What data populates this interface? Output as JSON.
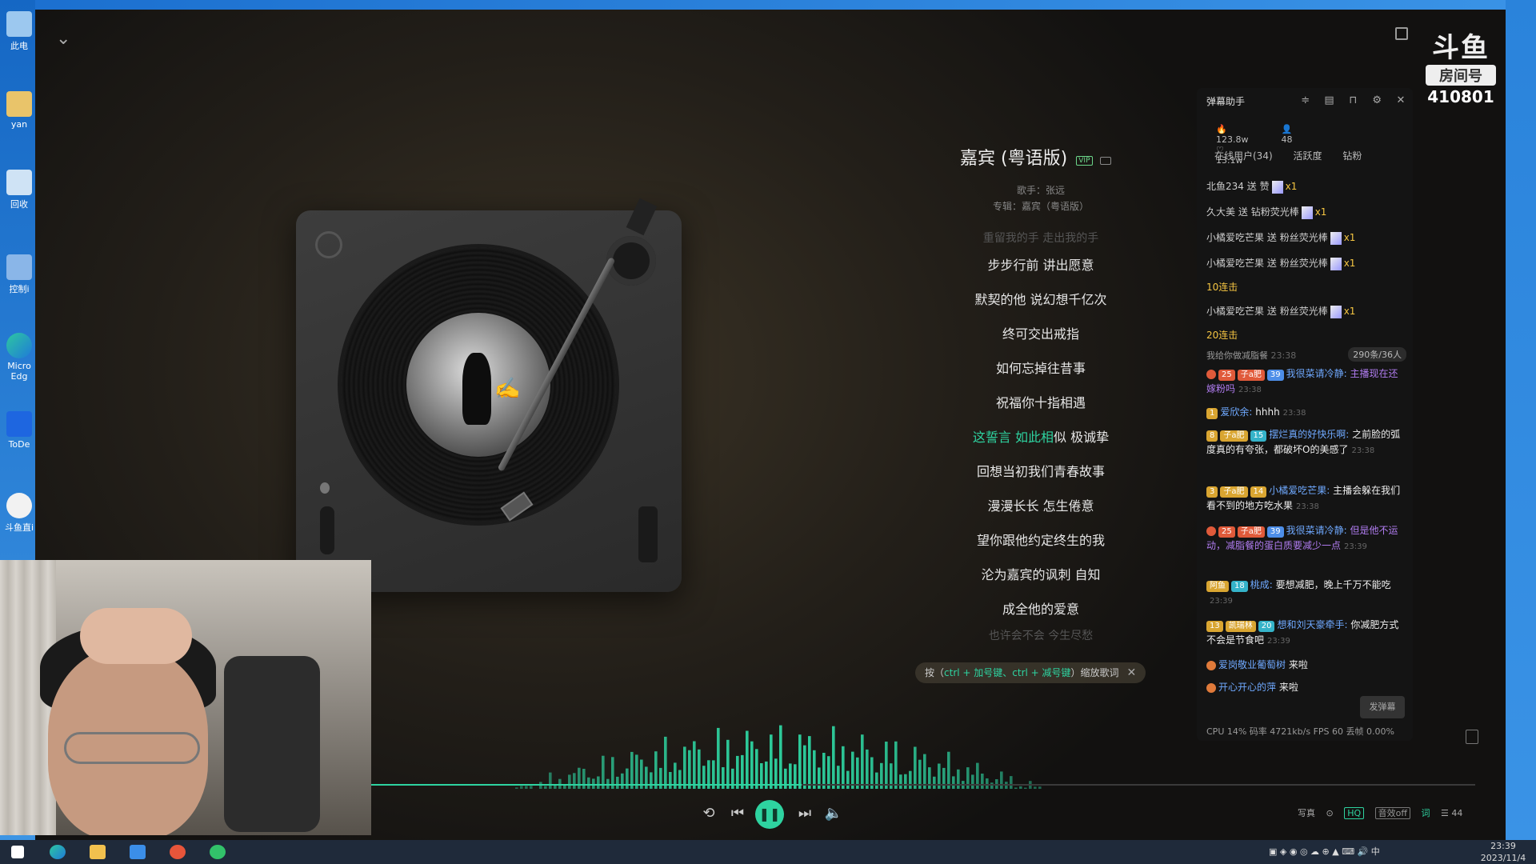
{
  "desktop": {
    "icons": [
      {
        "label": "此电"
      },
      {
        "label": "yan"
      },
      {
        "label": "回收"
      },
      {
        "label": "控制i"
      },
      {
        "label": "Micro Edg"
      },
      {
        "label": "ToDe"
      },
      {
        "label": "斗鱼直i"
      }
    ]
  },
  "room": {
    "logo_text": "斗鱼",
    "tag": "房间号",
    "number": "410801"
  },
  "song": {
    "title": "嘉宾 (粤语版)",
    "vip": "VIP",
    "singer": "歌手：张远",
    "album": "专辑：嘉宾（粤语版）"
  },
  "lyrics": {
    "prev_faded": "重留我的手 走出我的手",
    "lines": [
      "步步行前 讲出愿意",
      "默契的他 说幻想千亿次",
      "终可交出戒指",
      "如何忘掉往昔事",
      "祝福你十指相遇",
      "回想当初我们青春故事",
      "漫漫长长 怎生倦意",
      "望你跟他约定终生的我",
      "沦为嘉宾的讽刺 自知",
      "成全他的爱意"
    ],
    "active_line_hl": "这誓言 如此相",
    "active_line_rest": "似 极诚挚",
    "next_faded": "也许会不会 今生尽愁"
  },
  "zoom_tip": {
    "prefix": "按（",
    "keys": "ctrl + 加号键、ctrl + 减号键",
    "suffix": "）缩放歌词",
    "close": "✕"
  },
  "player": {
    "progress": 0.39,
    "accent": "#2ed3a0",
    "right_controls": {
      "xiezhen": "写真",
      "hq": "HQ",
      "sound": "音效off",
      "ci": "词",
      "count": "44"
    }
  },
  "danmu": {
    "title": "弹幕助手",
    "stats": {
      "heat": "123.8w",
      "users": "48",
      "likes": "13.1w"
    },
    "tabs": [
      "在线用户(34)",
      "活跃度",
      "钻粉"
    ],
    "gifts": [
      {
        "user": "北鱼234",
        "verb": "送",
        "item": "赞",
        "qty": "x1"
      },
      {
        "user": "久大美",
        "verb": "送",
        "item": "钻粉荧光棒",
        "qty": "x1"
      },
      {
        "user": "小橘爱吃芒果",
        "verb": "送",
        "item": "粉丝荧光棒",
        "qty": "x1"
      },
      {
        "user": "小橘爱吃芒果",
        "verb": "送",
        "item": "粉丝荧光棒",
        "qty": "x1"
      },
      {
        "user": "小橘爱吃芒果",
        "verb": "送",
        "item": "粉丝荧光棒",
        "qty": "x1"
      }
    ],
    "combos": [
      "10连击",
      "20连击"
    ],
    "separator": "我给你做减脂餐",
    "separator_time": "23:38",
    "count_badge": "290条/36人",
    "messages": [
      {
        "b1": "25",
        "b2": "子a肥",
        "b3": "39",
        "name": "我很菜请冷静:",
        "text": "主播现在还嫁粉吗",
        "time": "23:38"
      },
      {
        "b1": "1",
        "name": "爱欣余:",
        "text": "hhhh",
        "time": "23:38"
      },
      {
        "b1": "8",
        "b2": "子a肥",
        "b3": "15",
        "name": "摆烂真的好快乐啊:",
        "text": "之前脸的弧度真的有夸张，都破坏O的美感了",
        "time": "23:38"
      },
      {
        "b1": "3",
        "b2": "子a肥",
        "b3": "14",
        "name": "小橘爱吃芒果:",
        "text": "主播会躲在我们看不到的地方吃水果",
        "time": "23:38"
      },
      {
        "b1": "25",
        "b2": "子a肥",
        "b3": "39",
        "name": "我很菜请冷静:",
        "text": "但是他不运动，减脂餐的蛋白质要减少一点",
        "time": "23:39"
      },
      {
        "b1": "阿鱼",
        "b3": "18",
        "name": "桃成:",
        "text": "要想减肥，晚上千万不能吃",
        "time": "23:39"
      },
      {
        "b1": "13",
        "b2": "凯瑞林",
        "b3": "20",
        "name": "想和刘天豪牵手:",
        "text": "你减肥方式不会是节食吧",
        "time": "23:39"
      },
      {
        "name": "爱岗敬业葡萄树",
        "text": "来啦"
      },
      {
        "name": "开心开心的萍",
        "text": "来啦"
      }
    ],
    "send": "发弹幕",
    "footer": "CPU 14%  码率 4721kb/s  FPS 60  丢帧 0.00%"
  },
  "taskbar": {
    "tray_text": "中",
    "time": "23:39",
    "date": "2023/11/4"
  }
}
